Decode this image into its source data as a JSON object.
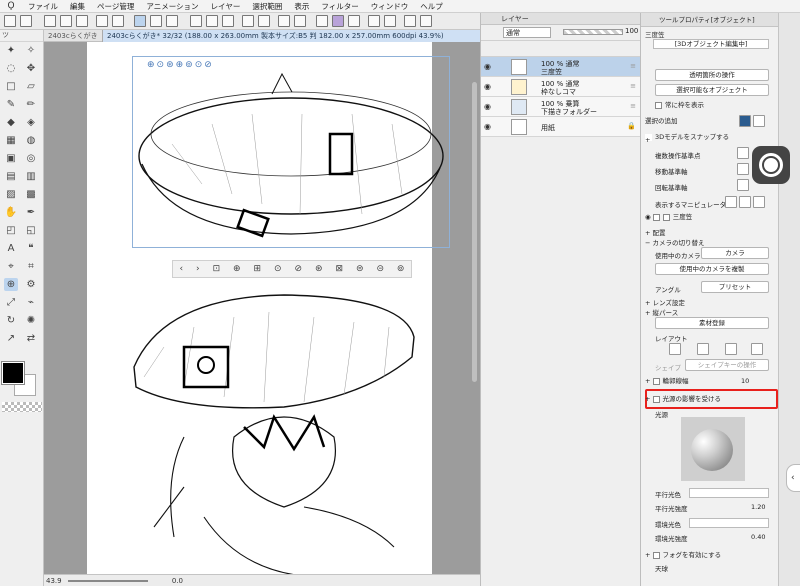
{
  "menu": {
    "items": [
      "ファイル",
      "編集",
      "ページ管理",
      "アニメーション",
      "レイヤー",
      "選択範囲",
      "表示",
      "フィルター",
      "ウィンドウ",
      "ヘルプ"
    ]
  },
  "toolbox": {
    "header": "ツ"
  },
  "document_tabs": {
    "inactive": "2403cらくがき",
    "active": "2403cらくがき* 32/32 (188.00 x 263.00mm 製本サイズ:B5 判 182.00 x 257.00mm 600dpi 43.9%)"
  },
  "canvas": {
    "float_bar_icons": [
      "‹",
      "›",
      "⊡",
      "⊕",
      "⊞",
      "⊙",
      "⊘",
      "⊛",
      "⊠",
      "⊜",
      "⊝",
      "⊚"
    ]
  },
  "status": {
    "zoom": "43.9",
    "rotation": "0.0"
  },
  "layer_panel": {
    "title": "レイヤー",
    "blend_mode": "通常",
    "opacity": "100",
    "layers": [
      {
        "line1": "100 % 通常",
        "line2": "三度笠",
        "selected": true
      },
      {
        "line1": "100 % 通常",
        "line2": "枠なしコマ",
        "selected": false
      },
      {
        "line1": "100 % 乗算",
        "line2": "下描きフォルダー",
        "selected": false
      },
      {
        "line1": "用紙",
        "line2": "",
        "selected": false
      }
    ]
  },
  "tool_property": {
    "title": "ツールプロパティ[オブジェクト]",
    "subtitle": "三度笠",
    "mode_label": "[3Dオブジェクト編集中]",
    "transparent_action": "透明箇所の操作",
    "selectable_objects": "選択可能なオブジェクト",
    "always_show_frame": "常に枠を表示",
    "selection_add": "選択の追加",
    "snap_3d": "3Dモデルをスナップする",
    "multi_op_base": "複数操作基準点",
    "move_base": "移動基準軸",
    "rotate_base": "回転基準軸",
    "show_manipulator": "表示するマニピュレータ",
    "object_name": "三度笠",
    "placement": "配置",
    "camera_switch": "カメラの切り替え",
    "camera_in_use": "使用中のカメラ",
    "camera": "カメラ",
    "duplicate_camera": "使用中のカメラを複製",
    "angle": "アングル",
    "preset": "プリセット",
    "lens": "レンズ設定",
    "perspective": "縦パース",
    "register_material": "素材登録",
    "layout": "レイアウト",
    "shape": "シェイプ",
    "shapekey_op": "シェイプキーの操作",
    "outline_width": "輪郭線幅",
    "outline_width_value": "10",
    "light_effect": "光源の影響を受ける",
    "light_source": "光源",
    "parallel_color": "平行光色",
    "parallel_intensity": "平行光強度",
    "parallel_intensity_value": "1.20",
    "ambient_color": "環境光色",
    "ambient_intensity": "環境光強度",
    "ambient_intensity_value": "0.40",
    "fog": "フォグを有効にする",
    "sky": "天球"
  },
  "colors": {
    "accent": "#2b5c8f",
    "highlight": "#e8201c",
    "selection": "#bcd2ea"
  }
}
